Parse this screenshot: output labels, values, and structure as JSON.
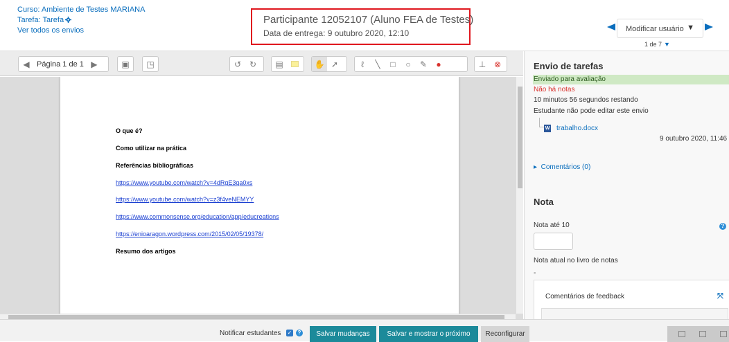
{
  "header": {
    "course": "Curso: Ambiente de Testes MARIANA",
    "assignment": "Tarefa: Tarefa",
    "view_all": "Ver todos os envios",
    "participant": "Participante 12052107 (Aluno FEA de Testes)",
    "due_date": "Data de entrega: 9 outubro 2020, 12:10",
    "change_user": "Modificar usuário",
    "user_count": "1 de 7"
  },
  "toolbar": {
    "page_label": "Página 1 de 1"
  },
  "document": {
    "lines": [
      {
        "text": "O que é?",
        "kind": "bold"
      },
      {
        "text": " Como utilizar na prática",
        "kind": "bold"
      },
      {
        "text": "Referências bibliográficas",
        "kind": "bold"
      },
      {
        "text": "https://www.youtube.com/watch?v=4dRgE3qa0xs",
        "kind": "link"
      },
      {
        "text": "https://www.youtube.com/watch?v=z3f4veNEMYY",
        "kind": "link"
      },
      {
        "text": "https://www.commonsense.org/education/app/educreations",
        "kind": "link"
      },
      {
        "text": "https://enioaragon.wordpress.com/2015/02/05/19378/",
        "kind": "link"
      },
      {
        "text": "Resumo dos artigos",
        "kind": "bold"
      }
    ]
  },
  "submission": {
    "title": "Envio de tarefas",
    "status_sent": "Enviado para avaliação",
    "status_grade": "Não há notas",
    "time_left": "10 minutos 56 segundos restando",
    "edit_status": "Estudante não pode editar este envio",
    "file_name": "trabalho.docx",
    "file_date": "9 outubro 2020, 11:46",
    "comments": "Comentários (0)"
  },
  "grade": {
    "title": "Nota",
    "grade_label": "Nota até 10",
    "grade_value": "",
    "current_label": "Nota atual no livro de notas",
    "current_value": "-",
    "feedback_label": "Comentários de feedback"
  },
  "footer": {
    "notify_label": "Notificar estudantes",
    "notify_checked": true,
    "save": "Salvar mudanças",
    "save_next": "Salvar e mostrar o próximo",
    "reset": "Reconfigurar"
  },
  "colors": {
    "accent": "#0a6ebd",
    "button": "#1c8a9a",
    "highlight_border": "#e0171e",
    "status_ok_bg": "#cfe9c4",
    "status_grade": "#d9322d"
  }
}
